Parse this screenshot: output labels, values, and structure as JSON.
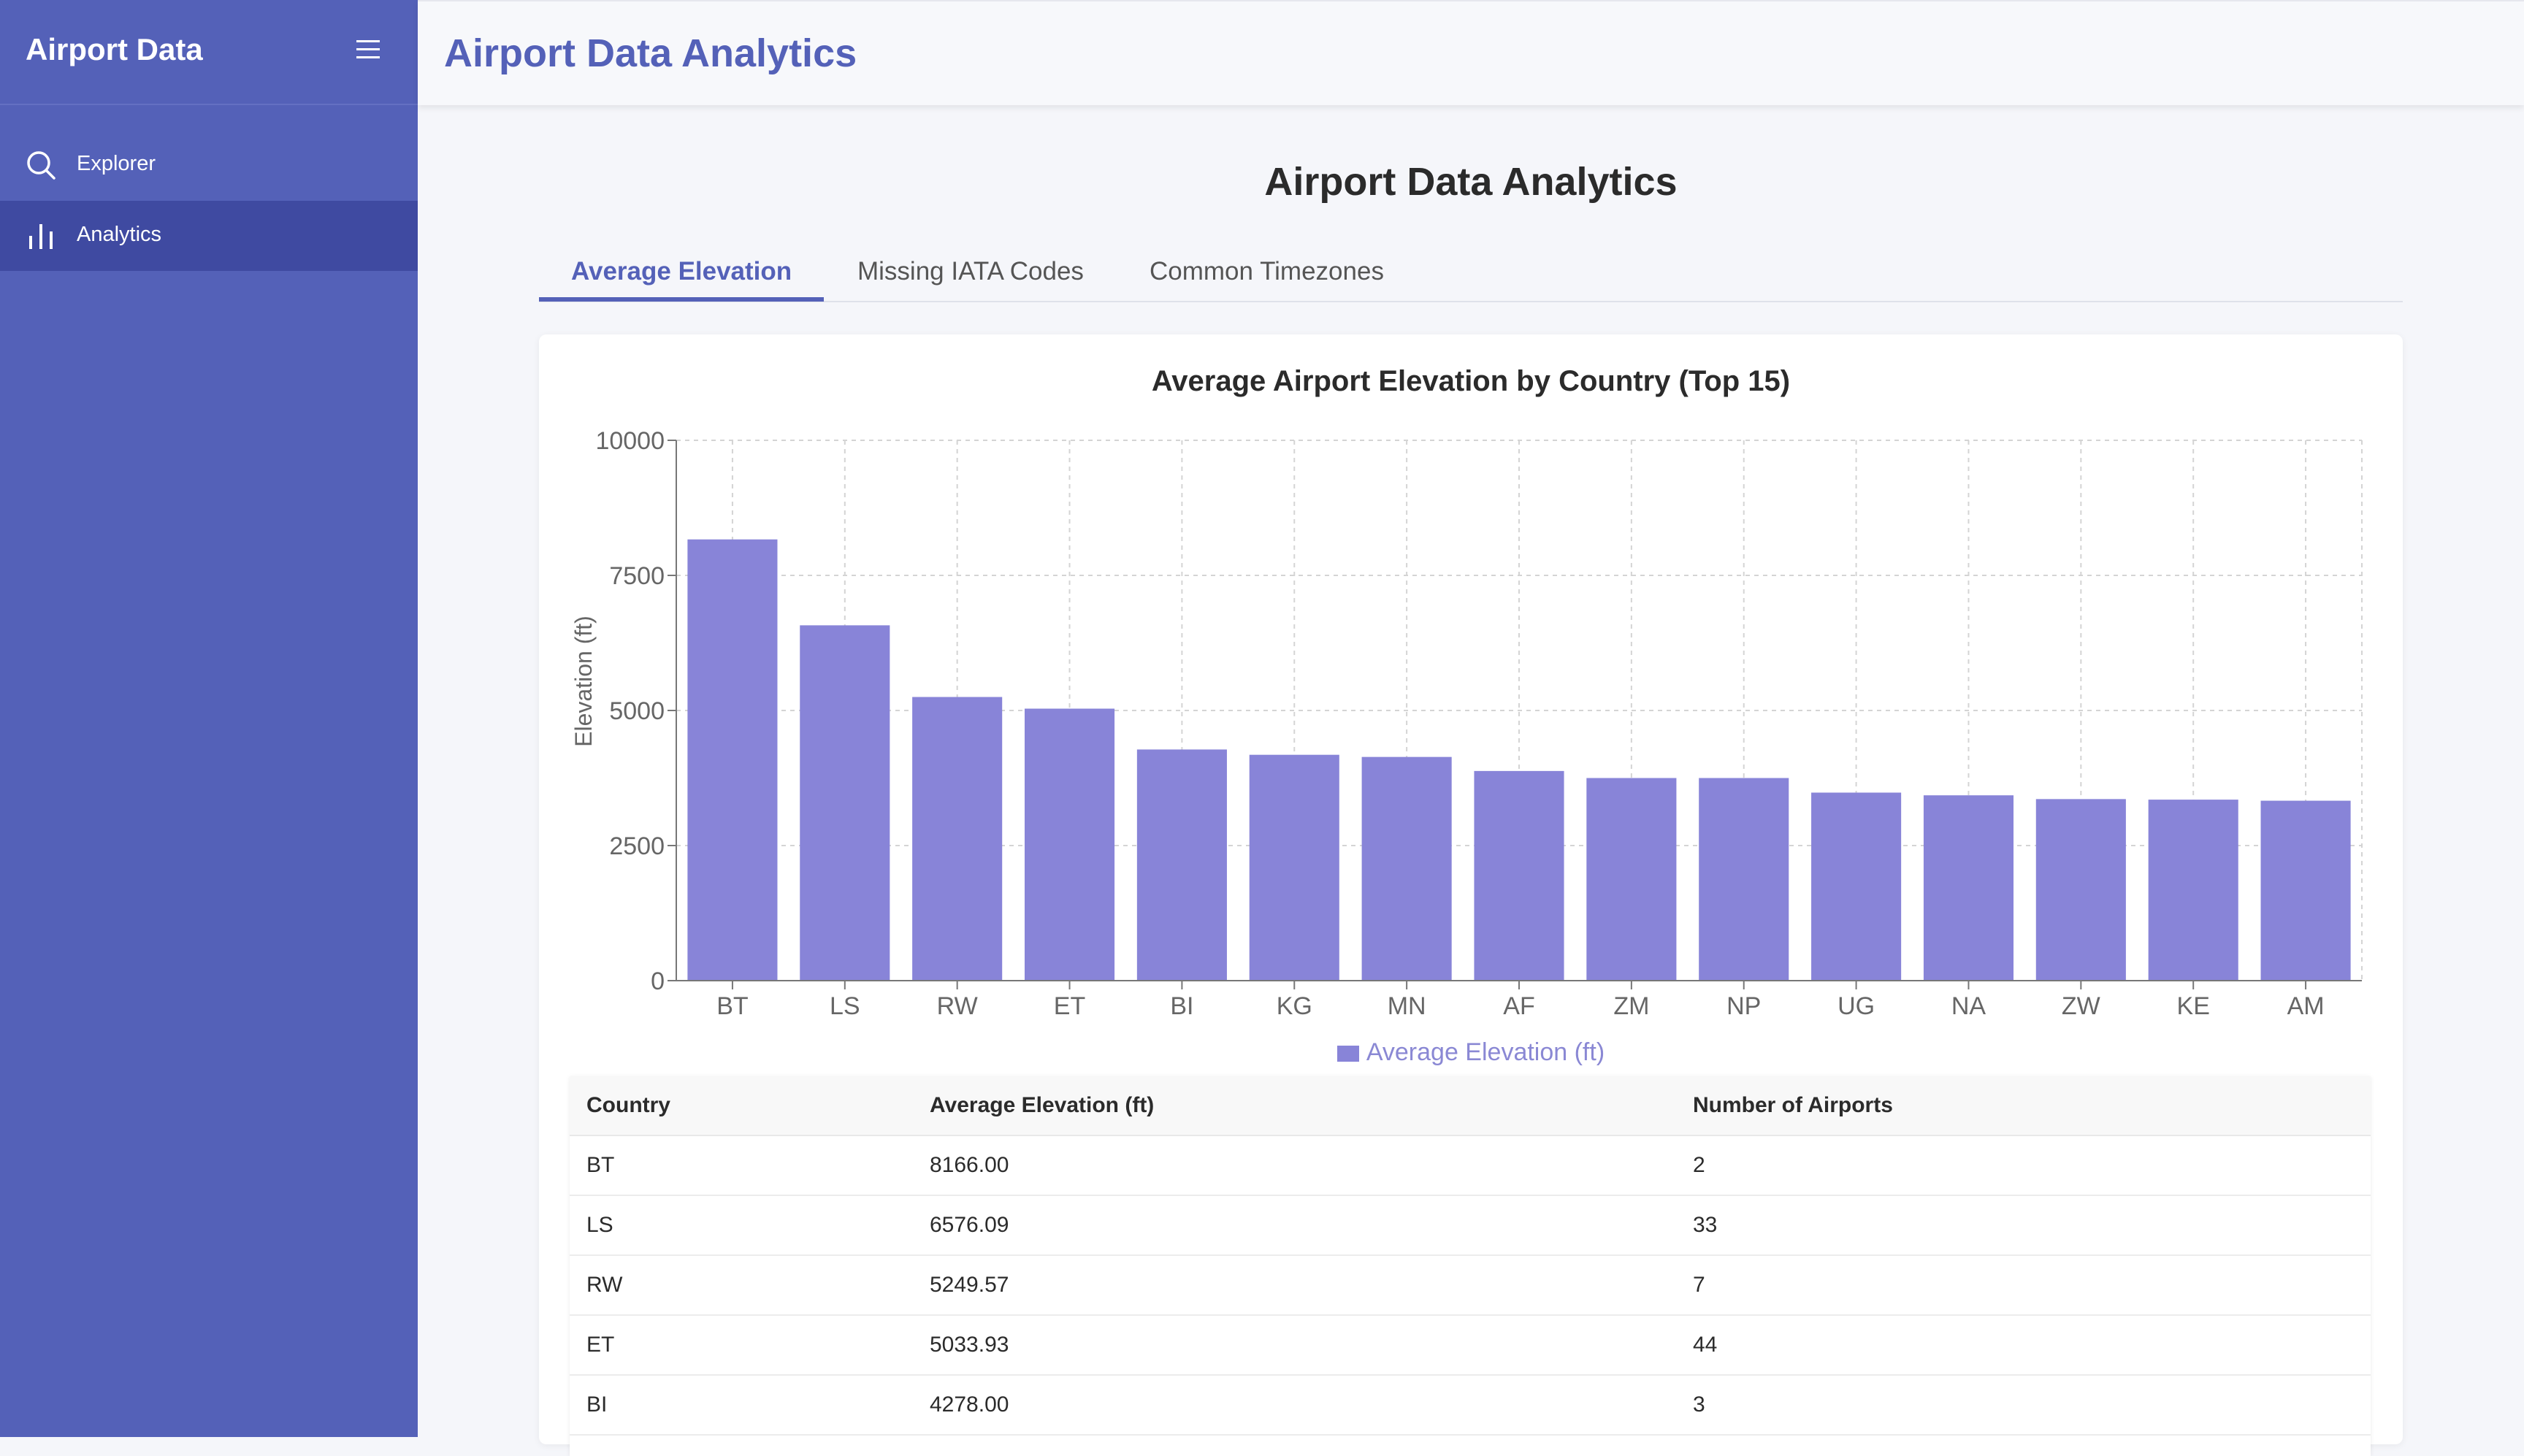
{
  "sidebar": {
    "title": "Airport Data",
    "items": [
      {
        "label": "Explorer",
        "icon": "search-icon"
      },
      {
        "label": "Analytics",
        "icon": "bar-chart-icon",
        "active": true
      }
    ]
  },
  "topbar": {
    "title": "Airport Data Analytics"
  },
  "page": {
    "heading": "Airport Data Analytics"
  },
  "tabs": [
    {
      "label": "Average Elevation",
      "active": true
    },
    {
      "label": "Missing IATA Codes"
    },
    {
      "label": "Common Timezones"
    }
  ],
  "chart_data": {
    "type": "bar",
    "title": "Average Airport Elevation by Country (Top 15)",
    "ylabel": "Elevation (ft)",
    "xlabel": "",
    "ylim": [
      0,
      10000
    ],
    "yticks": [
      0,
      2500,
      5000,
      7500,
      10000
    ],
    "categories": [
      "BT",
      "LS",
      "RW",
      "ET",
      "BI",
      "KG",
      "MN",
      "AF",
      "ZM",
      "NP",
      "UG",
      "NA",
      "ZW",
      "KE",
      "AM"
    ],
    "series": [
      {
        "name": "Average Elevation (ft)",
        "values": [
          8166,
          6576.09,
          5249.57,
          5033.93,
          4278,
          4180,
          4140,
          3880,
          3750,
          3750,
          3480,
          3430,
          3360,
          3350,
          3330
        ]
      }
    ],
    "grid": true,
    "legend": "bottom",
    "bar_color": "#8884d8"
  },
  "table": {
    "headers": [
      "Country",
      "Average Elevation (ft)",
      "Number of Airports"
    ],
    "rows": [
      [
        "BT",
        "8166.00",
        "2"
      ],
      [
        "LS",
        "6576.09",
        "33"
      ],
      [
        "RW",
        "5249.57",
        "7"
      ],
      [
        "ET",
        "5033.93",
        "44"
      ],
      [
        "BI",
        "4278.00",
        "3"
      ]
    ]
  },
  "colors": {
    "sidebar": "#5461b8",
    "sidebar_active": "#3f4aa1",
    "accent": "#5461b8",
    "bar": "#8884d8"
  }
}
